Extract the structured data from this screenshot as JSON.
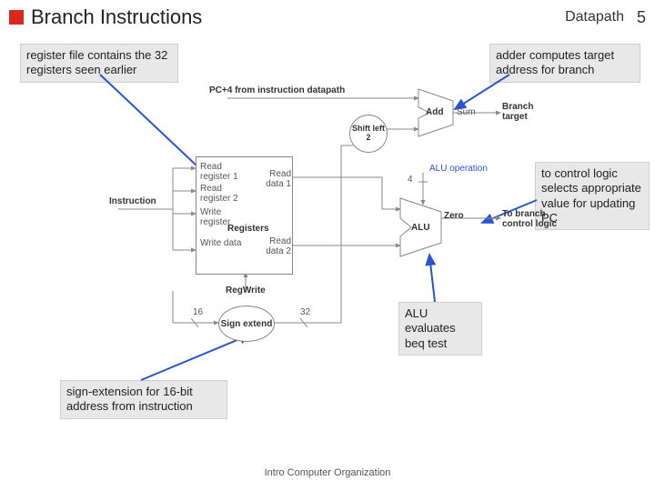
{
  "header": {
    "title": "Branch Instructions",
    "subtitle": "Datapath",
    "page": "5"
  },
  "callouts": {
    "regfile": "register file contains the 32 registers seen earlier",
    "adder": "adder computes target address for branch",
    "control": "to control logic selects appropriate value for updating PC",
    "alu": "ALU evaluates beq test",
    "signext": "sign-extension for 16-bit address from instruction"
  },
  "diagram": {
    "pc4": "PC+4 from instruction datapath",
    "instruction": "Instruction",
    "readreg1": "Read register 1",
    "readreg2": "Read register 2",
    "writereg": "Write register",
    "writedata": "Write data",
    "registers": "Registers",
    "readdata1": "Read data 1",
    "readdata2": "Read data 2",
    "regwrite": "RegWrite",
    "signextend": "Sign extend",
    "bits16": "16",
    "bits32": "32",
    "shiftleft2": "Shift left 2",
    "add": "Add",
    "sum": "Sum",
    "branchtarget": "Branch target",
    "alu": "ALU",
    "zero": "Zero",
    "aluop": "ALU operation",
    "aluopbits": "4",
    "tobranch": "To branch control logic"
  },
  "footer": "Intro Computer Organization"
}
